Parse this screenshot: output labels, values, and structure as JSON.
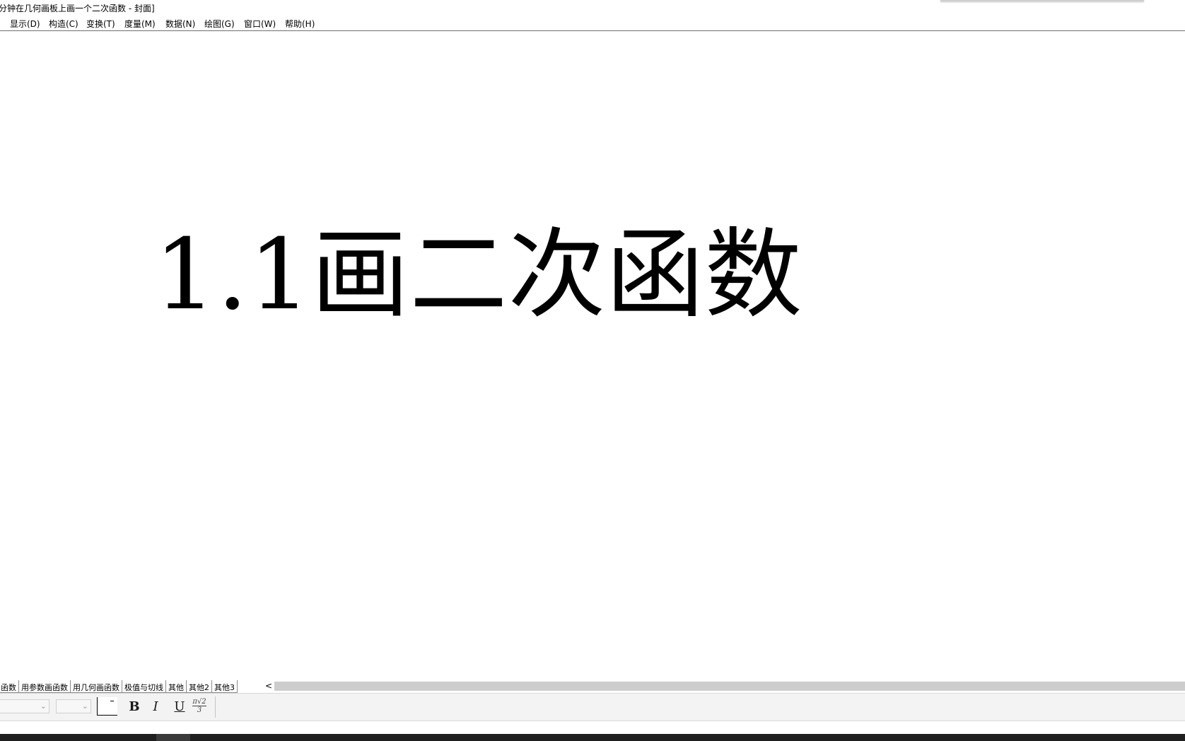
{
  "window": {
    "title": "分钟在几何画板上画一个二次函数 - 封面]"
  },
  "menu": {
    "items": [
      {
        "label": "显示(D)"
      },
      {
        "label": "构造(C)"
      },
      {
        "label": "变换(T)"
      },
      {
        "label": "度量(M)"
      },
      {
        "label": "数据(N)"
      },
      {
        "label": "绘图(G)"
      },
      {
        "label": "窗口(W)"
      },
      {
        "label": "帮助(H)"
      }
    ]
  },
  "canvas": {
    "cover_title": "1.1画二次函数"
  },
  "page_tabs": {
    "items": [
      {
        "label": "函数"
      },
      {
        "label": "用参数画函数"
      },
      {
        "label": "用几何画函数"
      },
      {
        "label": "极值与切线"
      },
      {
        "label": "其他"
      },
      {
        "label": "其他2"
      },
      {
        "label": "其他3"
      }
    ],
    "scroll_left_glyph": "<"
  },
  "format_toolbar": {
    "font_family_value": "",
    "font_size_value": "",
    "bold_glyph": "B",
    "italic_glyph": "I",
    "underline_glyph": "U",
    "math_numerator": "π√2",
    "math_denominator": "3",
    "text_color": "#000000"
  }
}
